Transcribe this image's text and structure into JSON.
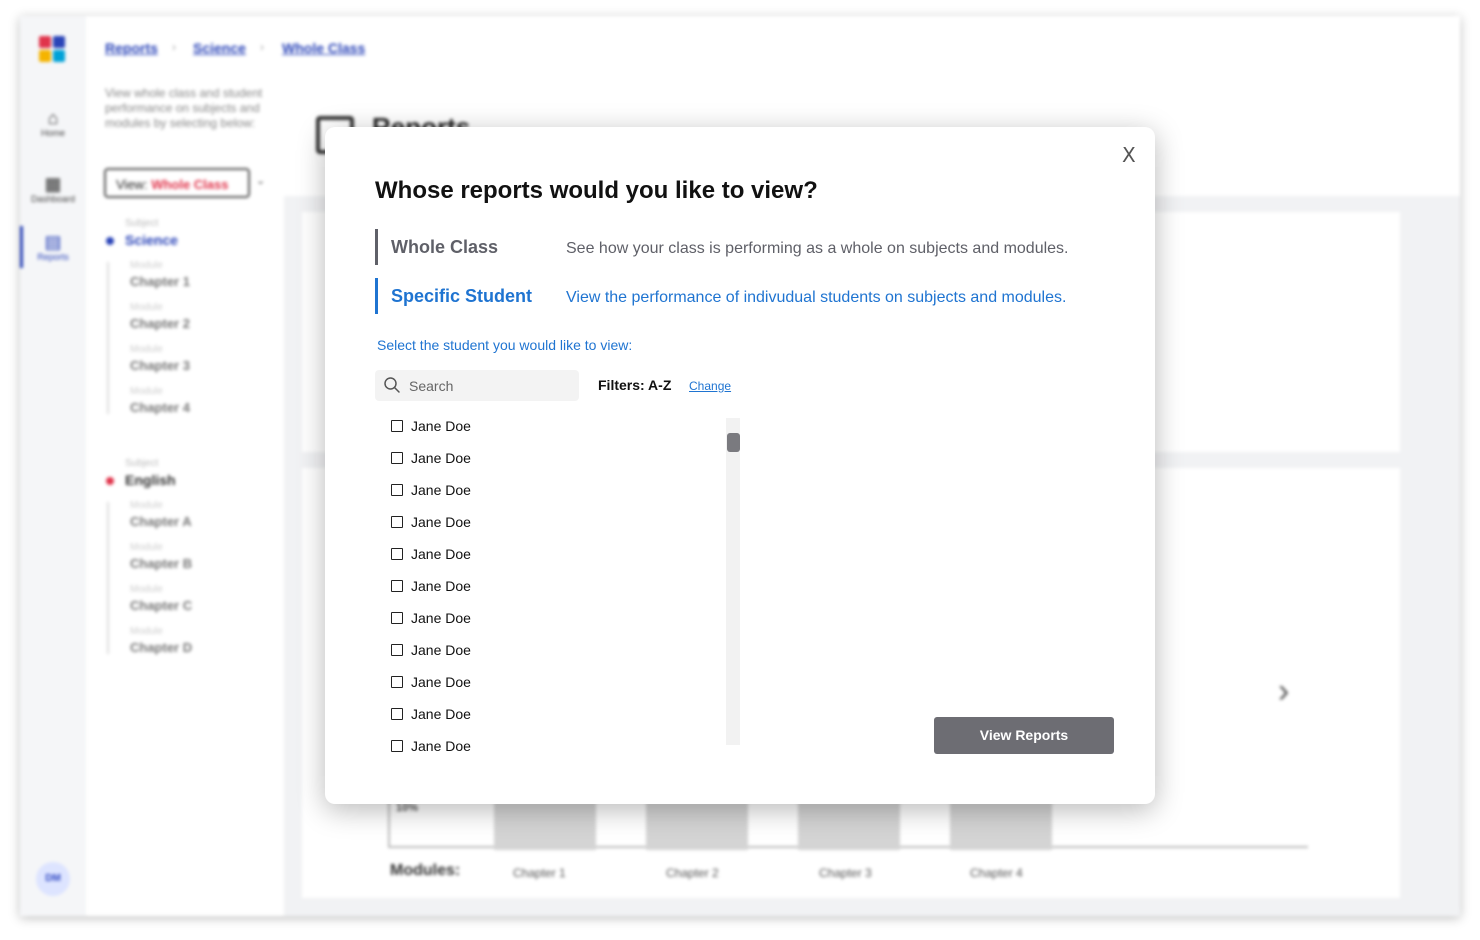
{
  "background": {
    "rail": {
      "items": [
        {
          "label": "Home",
          "icon": "home-icon",
          "glyph": "⌂"
        },
        {
          "label": "Dashboard",
          "icon": "dashboard-icon",
          "glyph": "▦"
        },
        {
          "label": "Reports",
          "icon": "reports-icon",
          "glyph": "▤"
        }
      ],
      "avatar_initials": "DM"
    },
    "breadcrumb": [
      "Reports",
      "Science",
      "Whole Class"
    ],
    "sidebar": {
      "description": "View whole class and student performance on subjects and modules by selecting below:",
      "view_prefix": "View:",
      "view_value": "Whole Class",
      "subjects": [
        {
          "label": "Subject",
          "name": "Science",
          "color": "#2a44b8",
          "modules": [
            {
              "label": "Module",
              "name": "Chapter 1"
            },
            {
              "label": "Module",
              "name": "Chapter 2"
            },
            {
              "label": "Module",
              "name": "Chapter 3"
            },
            {
              "label": "Module",
              "name": "Chapter 4"
            }
          ]
        },
        {
          "label": "Subject",
          "name": "English",
          "color": "#e0344b",
          "modules": [
            {
              "label": "Module",
              "name": "Chapter A"
            },
            {
              "label": "Module",
              "name": "Chapter B"
            },
            {
              "label": "Module",
              "name": "Chapter C"
            },
            {
              "label": "Module",
              "name": "Chapter D"
            }
          ]
        }
      ]
    },
    "page_title": "Reports",
    "chart": {
      "tick": "10%",
      "modules_label": "Modules:",
      "chapters": [
        "Chapter 1",
        "Chapter 2",
        "Chapter 3",
        "Chapter 4"
      ]
    }
  },
  "modal": {
    "close_label": "X",
    "title": "Whose reports would you like to view?",
    "options": [
      {
        "title": "Whole Class",
        "description": "See how your class is performing as a whole on subjects and modules.",
        "selected": false
      },
      {
        "title": "Specific Student",
        "description": "View the performance of indivudual students on subjects and modules.",
        "selected": true
      }
    ],
    "select_prompt": "Select the student you would like to view:",
    "search_placeholder": "Search",
    "filters_label": "Filters: A-Z",
    "change_label": "Change",
    "students": [
      "Jane Doe",
      "Jane Doe",
      "Jane Doe",
      "Jane Doe",
      "Jane Doe",
      "Jane Doe",
      "Jane Doe",
      "Jane Doe",
      "Jane Doe",
      "Jane Doe",
      "Jane Doe"
    ],
    "view_button": "View Reports"
  },
  "colors": {
    "accent": "#1f74d1",
    "brand_blue": "#2a44b8",
    "brand_red": "#e0344b",
    "button_gray": "#6d6d73"
  }
}
